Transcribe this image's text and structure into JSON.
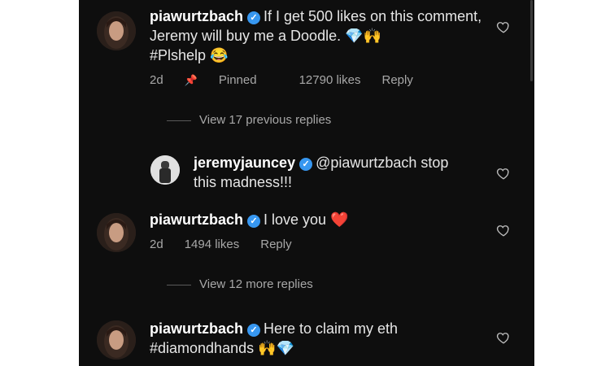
{
  "comments": [
    {
      "username": "piawurtzbach",
      "text": "If I get 500 likes on this comment, Jeremy will buy me a Doodle. 💎🙌",
      "text_line2": "#Plshelp 😂",
      "time": "2d",
      "pinned": "Pinned",
      "likes": "12790 likes",
      "reply": "Reply",
      "view_replies": "View 17 previous replies"
    },
    {
      "username": "jeremyjauncey",
      "text": "@piawurtzbach stop",
      "text_line2": "this madness!!!"
    },
    {
      "username": "piawurtzbach",
      "text": "I love you ❤️",
      "time": "2d",
      "likes": "1494 likes",
      "reply": "Reply",
      "view_replies": "View 12 more replies"
    },
    {
      "username": "piawurtzbach",
      "text": "Here to claim my eth",
      "text_line2": "#diamondhands 🙌💎"
    }
  ],
  "colors": {
    "background": "#0e0e0e",
    "verified": "#3797f0",
    "muted_text": "#a8a8a8"
  },
  "icons": {
    "verified": "verified-badge-icon",
    "pin": "pin-icon",
    "heart": "heart-outline-icon"
  }
}
